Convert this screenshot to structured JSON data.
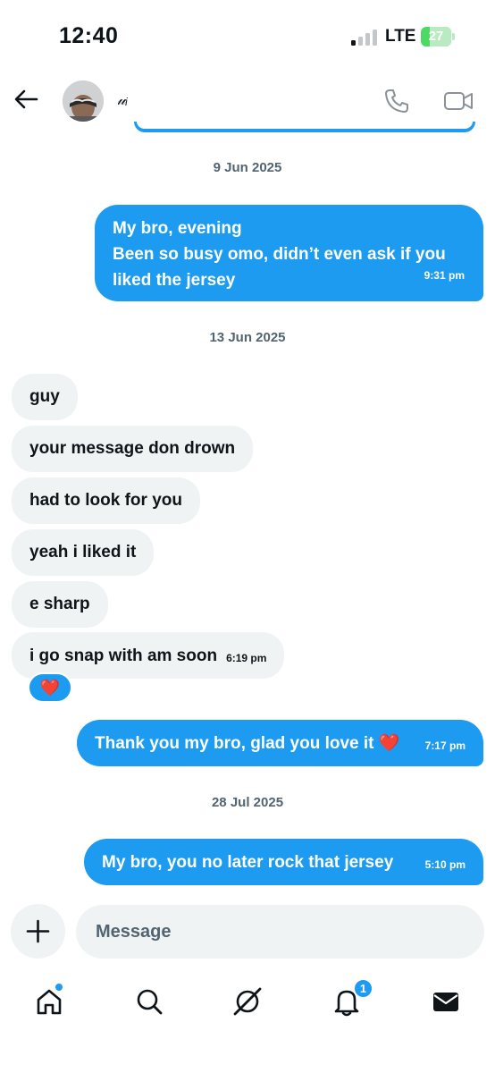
{
  "status_bar": {
    "time": "12:40",
    "network": "LTE",
    "battery": "27"
  },
  "header": {
    "contact_name": "𝓊ᵢ",
    "icons": [
      "back-arrow-icon",
      "phone-icon",
      "video-icon"
    ]
  },
  "messages": {
    "date_1": "9 Jun 2025",
    "sent_1": {
      "lines": [
        "My bro, evening",
        "Been so busy omo, didn’t even ask if you",
        "liked the jersey"
      ],
      "time": "9:31 pm"
    },
    "date_2": "13 Jun 2025",
    "recv": [
      "guy",
      "your message don drown",
      "had to look for you",
      "yeah i liked it",
      "e sharp",
      "i go snap with am soon"
    ],
    "recv_time": "6:19 pm",
    "reaction": "❤️",
    "sent_2": {
      "text": "Thank you my bro, glad you love it ❤️",
      "time": "7:17 pm"
    },
    "date_3": "28 Jul 2025",
    "sent_3": {
      "text": "My bro, you no later rock that jersey",
      "time": "5:10 pm"
    }
  },
  "composer": {
    "placeholder": "Message"
  },
  "bottom_nav": {
    "items": [
      "home-icon",
      "search-icon",
      "grok-icon",
      "notifications-icon",
      "messages-icon"
    ],
    "notifications_count": "1"
  },
  "colors": {
    "accent": "#1d9bf0",
    "received_bubble": "#eff3f4",
    "muted_text": "#536471"
  }
}
